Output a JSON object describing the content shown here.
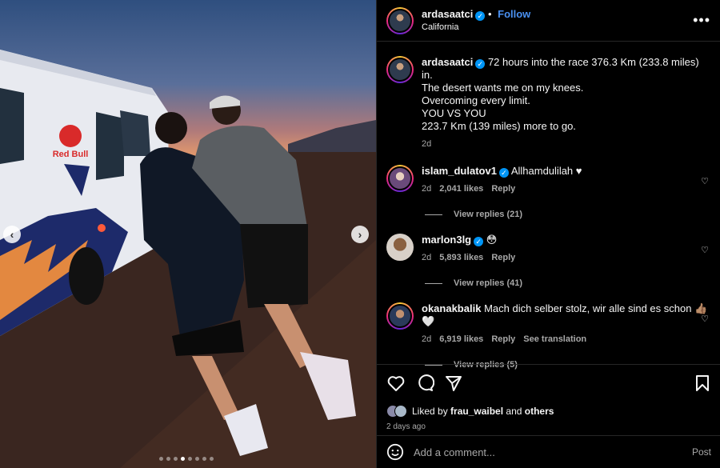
{
  "post": {
    "author": "ardasaatci",
    "follow_label": "Follow",
    "location": "California",
    "more_label": "•••",
    "caption": "72 hours into the race 376.3 Km (233.8 miles) in.\nThe desert wants me on my knees.\nOvercoming every limit.\nYOU VS YOU\n223.7 Km (139 miles) more to go.",
    "caption_age": "2d"
  },
  "comments": [
    {
      "user": "islam_dulatov1",
      "text": "Allhamdulilah ♥",
      "age": "2d",
      "likes": "2,041 likes",
      "reply": "Reply",
      "view_replies": "View replies (21)"
    },
    {
      "user": "marlon3lg",
      "text": "😳",
      "age": "2d",
      "likes": "5,893 likes",
      "reply": "Reply",
      "view_replies": "View replies (41)"
    },
    {
      "user": "okanakbalik",
      "text": "Mach dich selber stolz, wir alle sind es schon 👍🏽\n🤍",
      "age": "2d",
      "likes": "6,919 likes",
      "reply": "Reply",
      "translate": "See translation",
      "view_replies": "View replies (5)"
    }
  ],
  "likes": {
    "prefix": "Liked by ",
    "user": "frau_waibel",
    "middle": " and ",
    "others": "others"
  },
  "post_date": "2 days ago",
  "add_comment": {
    "placeholder": "Add a comment...",
    "post_label": "Post"
  },
  "carousel": {
    "slide_count": 8,
    "active_index": 3
  },
  "colors": {
    "accent": "#0095f6",
    "follow": "#4a90f0",
    "muted": "#a8a8a8",
    "background": "#000000"
  }
}
